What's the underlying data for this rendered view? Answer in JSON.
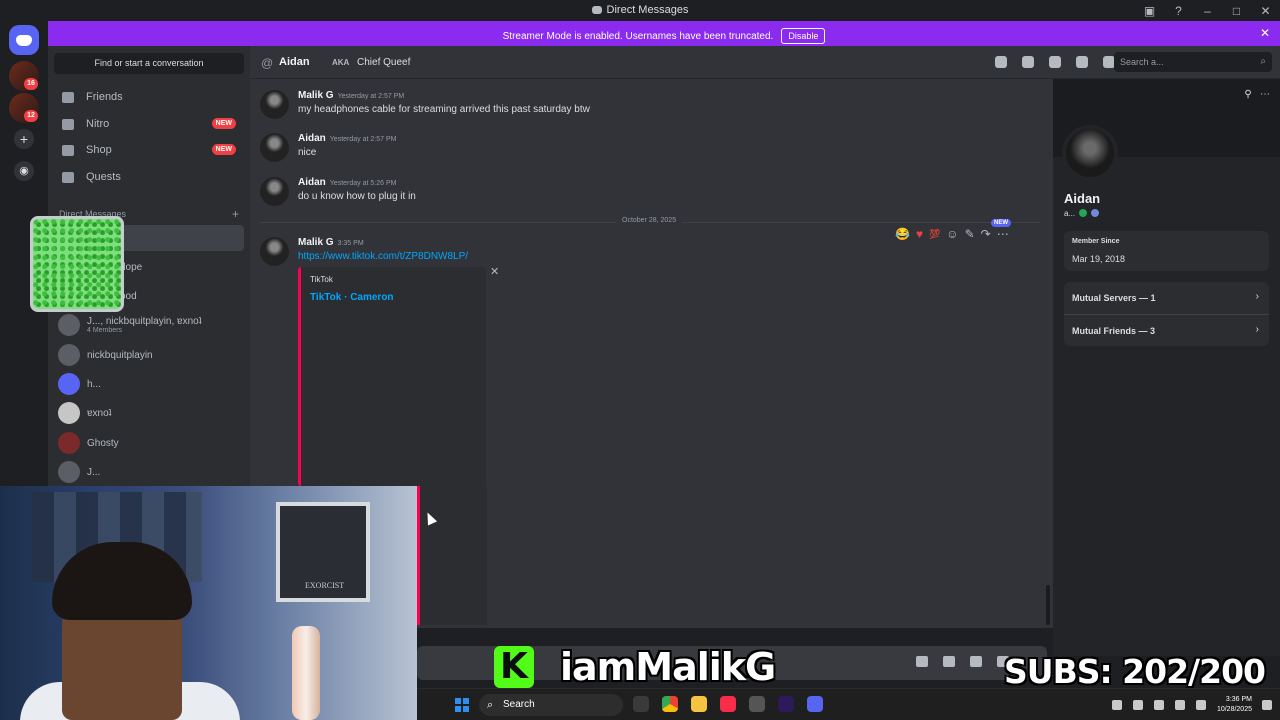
{
  "window": {
    "title": "Direct Messages"
  },
  "banner": {
    "message": "Streamer Mode is enabled. Usernames have been truncated.",
    "button": "Disable"
  },
  "rail": {
    "badges": [
      "16",
      "12"
    ]
  },
  "dm_sidebar": {
    "find_placeholder": "Find or start a conversation",
    "nav": [
      {
        "label": "Friends",
        "icon": "friends-icon"
      },
      {
        "label": "Nitro",
        "icon": "nitro-icon",
        "badge": "NEW"
      },
      {
        "label": "Shop",
        "icon": "shop-icon",
        "badge": "NEW"
      },
      {
        "label": "Quests",
        "icon": "quests-icon"
      }
    ],
    "section_title": "Direct Messages",
    "dms": [
      {
        "name": ""
      },
      {
        "name": "dope"
      },
      {
        "name": "ood"
      },
      {
        "name": "J..., nickbquitplayin, ɐxnoʇ",
        "sub": "4 Members"
      },
      {
        "name": "nickbquitplayin"
      },
      {
        "name": "h..."
      },
      {
        "name": "ɐxnoʇ"
      },
      {
        "name": "Ghosty"
      },
      {
        "name": "J..."
      }
    ]
  },
  "chat": {
    "header": {
      "name": "Aidan",
      "aka_label": "AKA",
      "nickname": "Chief Queef",
      "search_placeholder": "Search a..."
    },
    "messages": [
      {
        "author": "Malik G",
        "time": "Yesterday at 2:57 PM",
        "text": "my headphones cable for streaming arrived this past saturday btw"
      },
      {
        "author": "Aidan",
        "time": "Yesterday at 2:57 PM",
        "text": "nice"
      },
      {
        "author": "Aidan",
        "time": "Yesterday at 5:26 PM",
        "text": "do u know how to plug it in"
      }
    ],
    "date_divider": "October 28, 2025",
    "latest": {
      "author": "Malik G",
      "time": "3:35 PM",
      "link": "https://www.tiktok.com/t/ZP8DNW8LP/",
      "embed_provider": "TikTok",
      "embed_title": "TikTok · Cameron",
      "new_tag": "NEW"
    }
  },
  "profile": {
    "name": "Aidan",
    "tag": "a...",
    "member_since_label": "Member Since",
    "member_since": "Mar 19, 2018",
    "mutual_servers": "Mutual Servers — 1",
    "mutual_friends": "Mutual Friends — 3"
  },
  "overlay": {
    "handle": "iamMalikG",
    "kick_letter": "K",
    "subs": "SUBS: 202/200"
  },
  "camera": {
    "poster_text": "EXORCIST"
  },
  "taskbar": {
    "search_label": "Search",
    "time": "3:36 PM",
    "date": "10/28/2025"
  }
}
